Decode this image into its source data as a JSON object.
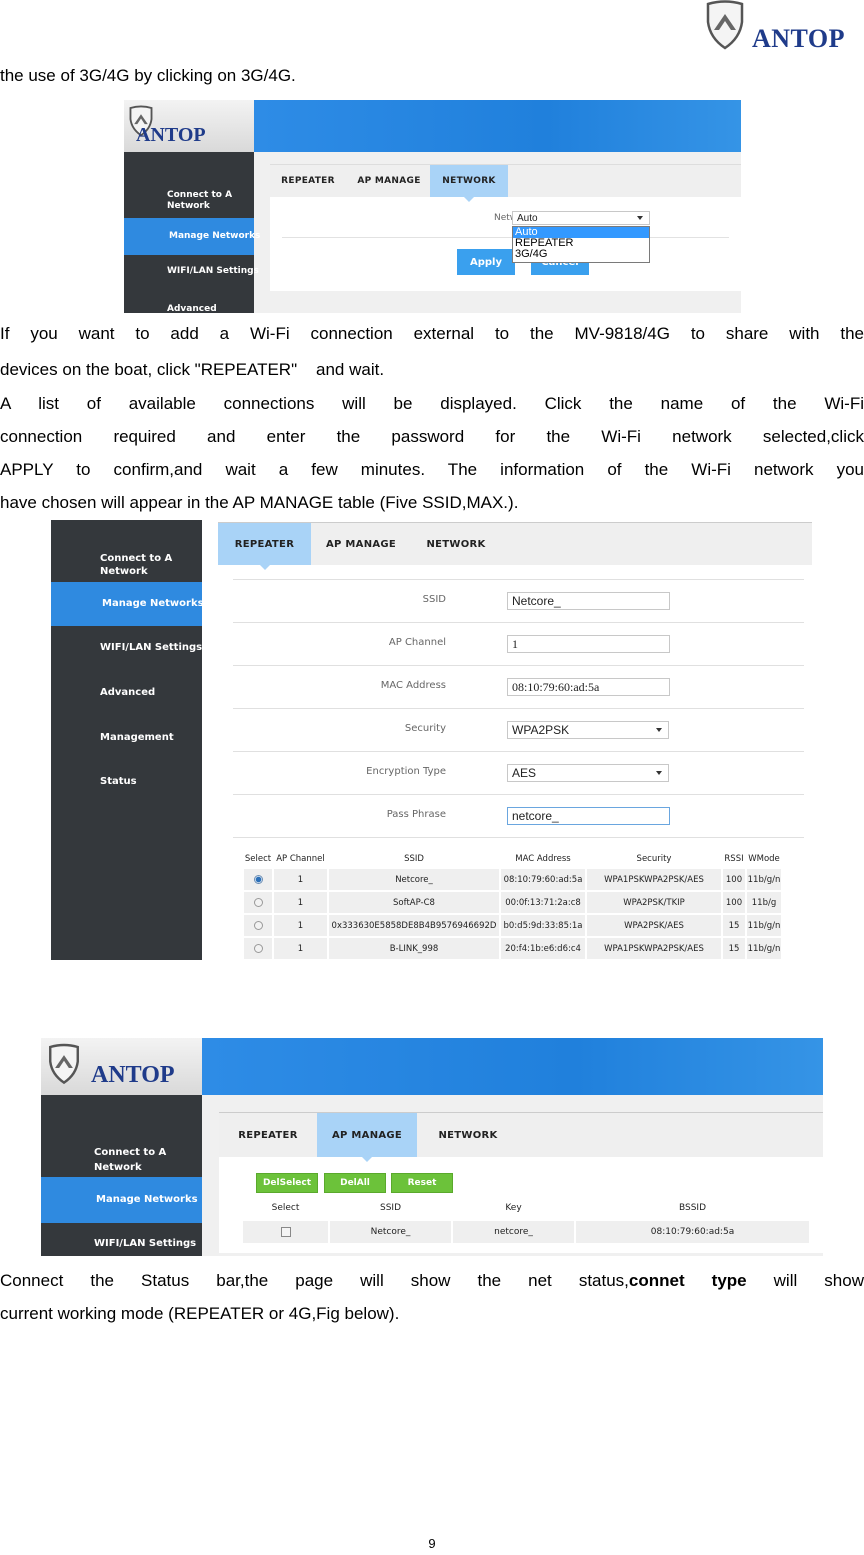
{
  "header": {
    "brand": "ANTOP"
  },
  "intro_text": "the use of 3G/4G by clicking on 3G/4G.",
  "fig1": {
    "brand": "ANTOP",
    "sidebar": [
      "Connect to A Network",
      "Manage Networks",
      "WIFI/LAN Settings",
      "Advanced"
    ],
    "active_sidebar_index": 1,
    "tabs": [
      "REPEATER",
      "AP MANAGE",
      "NETWORK"
    ],
    "active_tab": "NETWORK",
    "network_mode_label": "Network Mode",
    "network_mode_value": "Auto",
    "dropdown_options": [
      "Auto",
      "REPEATER",
      "3G/4G"
    ],
    "dropdown_selected": "Auto",
    "apply_label": "Apply",
    "cancel_label": "Cancel"
  },
  "para1": {
    "line1": "If you want to add a Wi-Fi connection external to the MV-9818/4G to share with the",
    "line2": "devices on the boat, click \"REPEATER\"    and wait.",
    "line3": "A list of available connections will be displayed. Click the name of the Wi-Fi",
    "line4": "connection required and enter the password for the Wi-Fi network selected,click",
    "line5": "APPLY to confirm,and wait a few minutes. The information of the Wi-Fi network you",
    "line6": "have chosen will appear in the AP MANAGE table (Five SSID,MAX.)."
  },
  "fig2": {
    "sidebar": [
      "Connect to A Network",
      "Manage Networks",
      "WIFI/LAN Settings",
      "Advanced",
      "Management",
      "Status"
    ],
    "active_sidebar_index": 1,
    "tabs": [
      "REPEATER",
      "AP MANAGE",
      "NETWORK"
    ],
    "active_tab": "REPEATER",
    "form": [
      {
        "label": "SSID",
        "value": "Netcore_",
        "type": "text"
      },
      {
        "label": "AP Channel",
        "value": "1",
        "type": "text"
      },
      {
        "label": "MAC Address",
        "value": "08:10:79:60:ad:5a",
        "type": "text"
      },
      {
        "label": "Security",
        "value": "WPA2PSK",
        "type": "select"
      },
      {
        "label": "Encryption Type",
        "value": "AES",
        "type": "select"
      },
      {
        "label": "Pass Phrase",
        "value": "netcore_",
        "type": "text"
      }
    ],
    "table": {
      "headers": [
        "Select",
        "AP Channel",
        "SSID",
        "MAC Address",
        "Security",
        "RSSI",
        "WMode"
      ],
      "rows": [
        {
          "selected": true,
          "channel": "1",
          "ssid": "Netcore_",
          "mac": "08:10:79:60:ad:5a",
          "security": "WPA1PSKWPA2PSK/AES",
          "rssi": "100",
          "wmode": "11b/g/n"
        },
        {
          "selected": false,
          "channel": "1",
          "ssid": "SoftAP-C8",
          "mac": "00:0f:13:71:2a:c8",
          "security": "WPA2PSK/TKIP",
          "rssi": "100",
          "wmode": "11b/g"
        },
        {
          "selected": false,
          "channel": "1",
          "ssid": "0x333630E5858DE8B4B9576946692D",
          "mac": "b0:d5:9d:33:85:1a",
          "security": "WPA2PSK/AES",
          "rssi": "15",
          "wmode": "11b/g/n"
        },
        {
          "selected": false,
          "channel": "1",
          "ssid": "B-LINK_998",
          "mac": "20:f4:1b:e6:d6:c4",
          "security": "WPA1PSKWPA2PSK/AES",
          "rssi": "15",
          "wmode": "11b/g/n"
        }
      ]
    }
  },
  "fig3": {
    "brand": "ANTOP",
    "sidebar": [
      "Connect to A Network",
      "Manage Networks",
      "WIFI/LAN Settings"
    ],
    "active_sidebar_index": 1,
    "tabs": [
      "REPEATER",
      "AP MANAGE",
      "NETWORK"
    ],
    "active_tab": "AP MANAGE",
    "buttons": [
      "DelSelect",
      "DelAll",
      "Reset"
    ],
    "table": {
      "headers": [
        "Select",
        "SSID",
        "Key",
        "BSSID"
      ],
      "rows": [
        {
          "checked": false,
          "ssid": "Netcore_",
          "key": "netcore_",
          "bssid": "08:10:79:60:ad:5a"
        }
      ]
    }
  },
  "para2": {
    "line1_pre": "Connect the Status bar,the page will show the net status,",
    "line1_bold": "connet type",
    "line1_post": " will show",
    "line2": "current working mode (REPEATER or 4G,Fig below)."
  },
  "page_number": "9"
}
